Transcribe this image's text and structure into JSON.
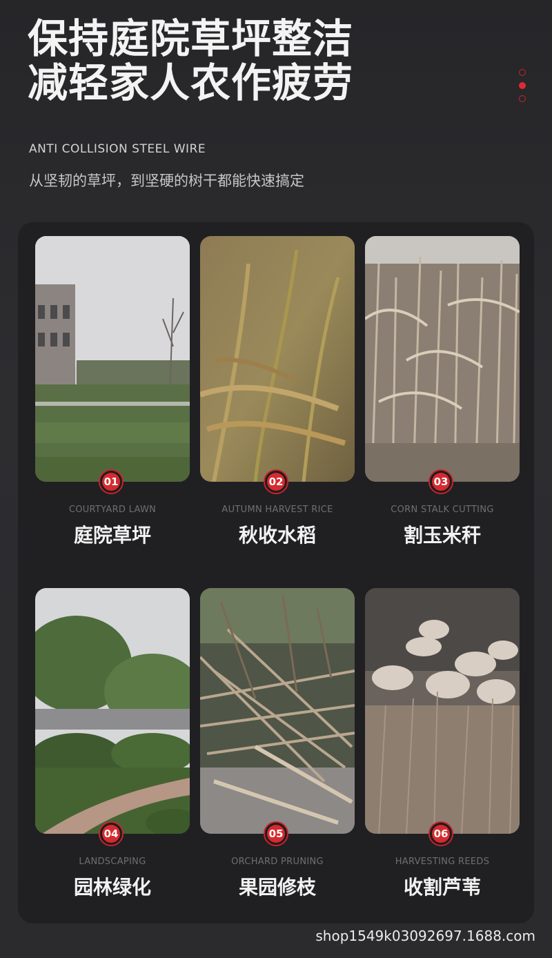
{
  "header": {
    "title_line1": "保持庭院草坪整洁",
    "title_line2": "减轻家人农作疲劳",
    "subtitle_en": "ANTI COLLISION STEEL WIRE",
    "subtitle_cn": "从坚韧的草坪，到坚硬的树干都能快速搞定"
  },
  "pager": {
    "count": 3,
    "active_index": 1
  },
  "cards": [
    {
      "number": "01",
      "label_en": "COURTYARD LAWN",
      "label_cn": "庭院草坪",
      "image": "lawn-photo"
    },
    {
      "number": "02",
      "label_en": "AUTUMN HARVEST RICE",
      "label_cn": "秋收水稻",
      "image": "rice-photo"
    },
    {
      "number": "03",
      "label_en": "CORN STALK CUTTING",
      "label_cn": "割玉米秆",
      "image": "corn-photo"
    },
    {
      "number": "04",
      "label_en": "LANDSCAPING",
      "label_cn": "园林绿化",
      "image": "garden-photo"
    },
    {
      "number": "05",
      "label_en": "ORCHARD PRUNING",
      "label_cn": "果园修枝",
      "image": "branches-photo"
    },
    {
      "number": "06",
      "label_en": "HARVESTING REEDS",
      "label_cn": "收割芦苇",
      "image": "reeds-photo"
    }
  ],
  "watermark": "shop1549k03092697.1688.com",
  "colors": {
    "accent": "#d52a2f",
    "background": "#2a2a2d",
    "panel": "#202023"
  }
}
